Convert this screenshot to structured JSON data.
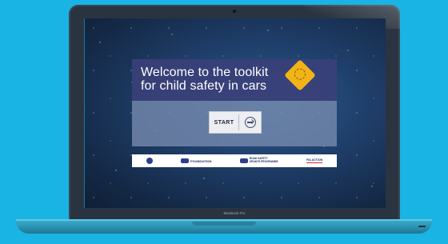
{
  "device": {
    "model_label": "MacBook Pro"
  },
  "toolkit": {
    "title_line1": "Welcome to the toolkit",
    "title_line2": "for child safety in cars",
    "start_label": "START",
    "badge_icon": "child-seat-warning-sign-icon",
    "start_icon": "arrow-right-circle-icon"
  },
  "logos": [
    {
      "name": "org-logo-1",
      "text": ""
    },
    {
      "name": "foundation-logo",
      "text": "FOUNDATION"
    },
    {
      "name": "road-safety-logo",
      "text_line1": "ROAD SAFETY",
      "text_line2": "GRANTS PROGRAMME"
    },
    {
      "name": "fia-action-logo",
      "text": "FIA ACTION"
    }
  ],
  "colors": {
    "background": "#19b4e4",
    "welcome_card": "#3a4078",
    "badge": "#f2b316",
    "start_area": "#788caf"
  }
}
